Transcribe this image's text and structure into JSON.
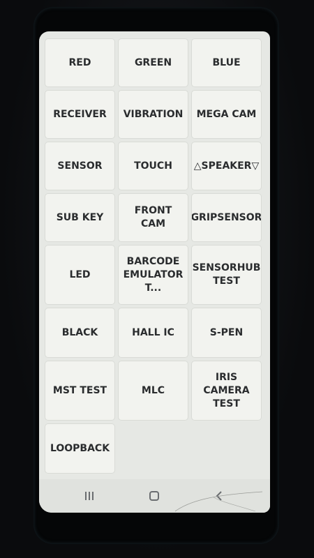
{
  "tests": [
    {
      "label": "RED"
    },
    {
      "label": "GREEN"
    },
    {
      "label": "BLUE"
    },
    {
      "label": "RECEIVER"
    },
    {
      "label": "VIBRATION"
    },
    {
      "label": "MEGA CAM"
    },
    {
      "label": "SENSOR"
    },
    {
      "label": "TOUCH"
    },
    {
      "label": "△SPEAKER▽"
    },
    {
      "label": "SUB KEY"
    },
    {
      "label": "FRONT CAM"
    },
    {
      "label": "GRIPSENSOR"
    },
    {
      "label": "LED"
    },
    {
      "label": "BARCODE\nEMULATOR T..."
    },
    {
      "label": "SENSORHUB\nTEST"
    },
    {
      "label": "BLACK"
    },
    {
      "label": "HALL IC"
    },
    {
      "label": "S-PEN"
    },
    {
      "label": "MST TEST"
    },
    {
      "label": "MLC"
    },
    {
      "label": "IRIS CAMERA\nTEST"
    },
    {
      "label": "LOOPBACK"
    }
  ],
  "navbar": {
    "recents_icon": "recents-icon",
    "home_icon": "home-icon",
    "back_icon": "back-icon"
  }
}
